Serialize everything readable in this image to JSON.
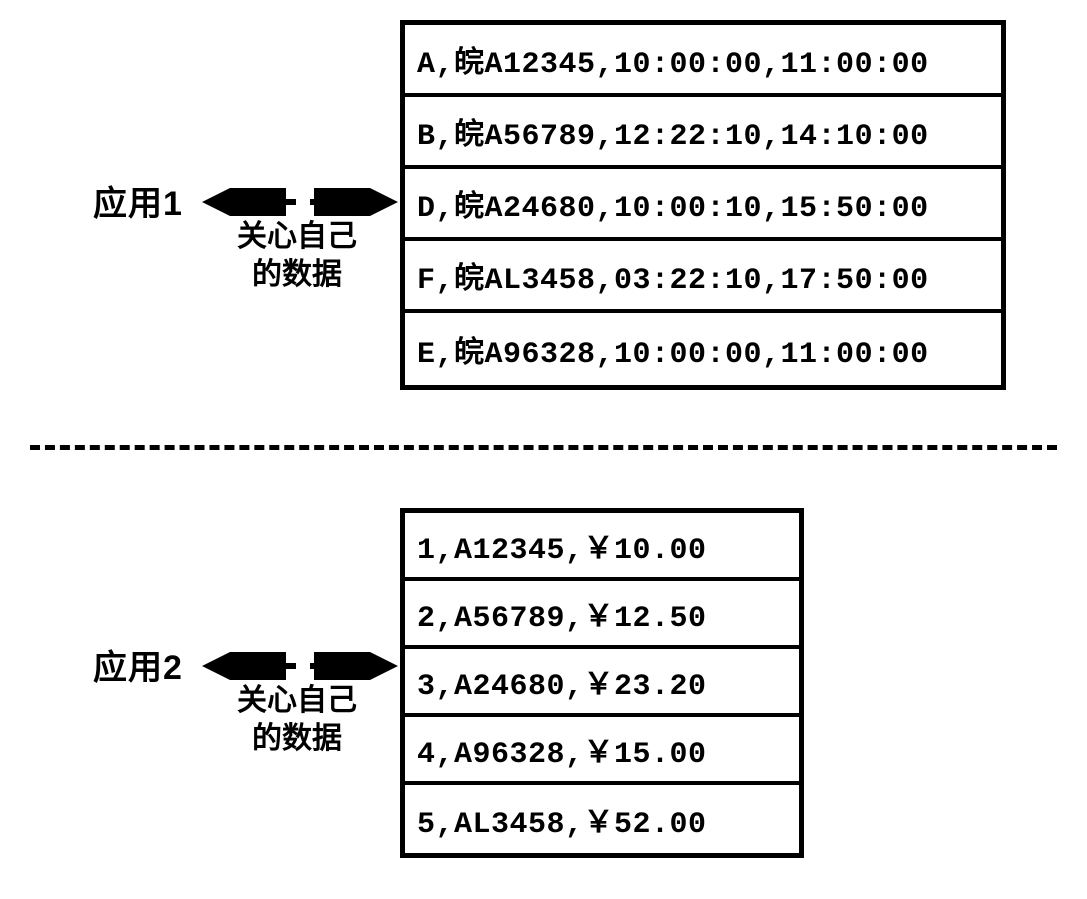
{
  "section1": {
    "appLabel": "应用1",
    "arrowCaptionLine1": "关心自己",
    "arrowCaptionLine2": "的数据",
    "rows": [
      "A,皖A12345,10:00:00,11:00:00",
      "B,皖A56789,12:22:10,14:10:00",
      "D,皖A24680,10:00:10,15:50:00",
      "F,皖AL3458,03:22:10,17:50:00",
      "E,皖A96328,10:00:00,11:00:00"
    ]
  },
  "section2": {
    "appLabel": "应用2",
    "arrowCaptionLine1": "关心自己",
    "arrowCaptionLine2": "的数据",
    "rows": [
      "1,A12345,￥10.00",
      "2,A56789,￥12.50",
      "3,A24680,￥23.20",
      "4,A96328,￥15.00",
      "5,AL3458,￥52.00"
    ]
  }
}
